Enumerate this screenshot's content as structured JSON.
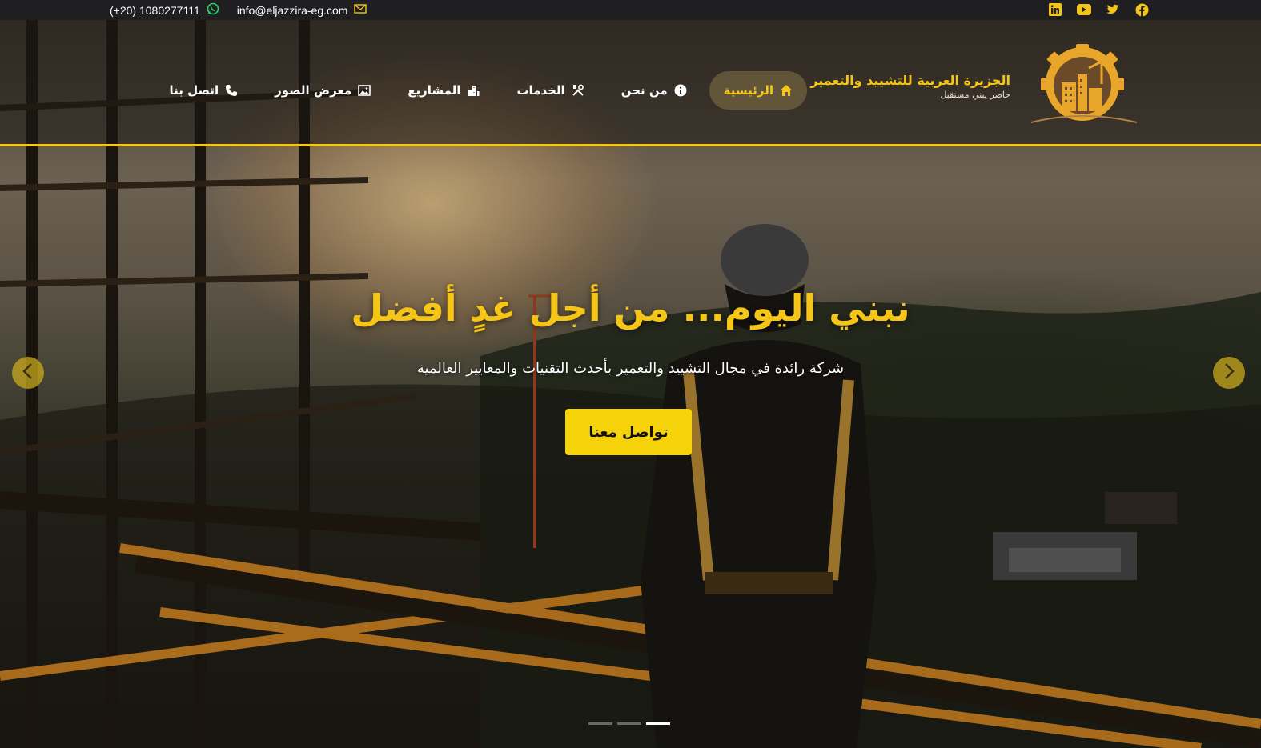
{
  "topbar": {
    "phone": "(+20) 1080277111",
    "email": "info@eljazzira-eg.com",
    "phone_icon": "whatsapp-icon",
    "email_icon": "envelope-icon",
    "socials": [
      "linkedin-icon",
      "youtube-icon",
      "twitter-icon",
      "facebook-icon"
    ]
  },
  "brand": {
    "title": "الجزيرة العربية للتشييد والتعمير",
    "tagline": "حاضر يبني مستقبل"
  },
  "nav": {
    "items": [
      {
        "label": "الرئيسية",
        "icon": "home-icon",
        "active": true
      },
      {
        "label": "من نحن",
        "icon": "info-icon",
        "active": false
      },
      {
        "label": "الخدمات",
        "icon": "tools-icon",
        "active": false
      },
      {
        "label": "المشاريع",
        "icon": "buildings-icon",
        "active": false
      },
      {
        "label": "معرض الصور",
        "icon": "image-icon",
        "active": false
      },
      {
        "label": "اتصل بنا",
        "icon": "phone-icon",
        "active": false
      }
    ]
  },
  "hero": {
    "title": "نبني اليوم... من أجل غدٍ أفضل",
    "subtitle": "شركة رائدة في مجال التشييد والتعمير بأحدث التقنيات والمعايير العالمية",
    "cta_label": "تواصل معنا",
    "slides_count": 3,
    "active_slide": 3
  },
  "colors": {
    "accent": "#f5c518",
    "button": "#f5d20a",
    "topbar": "#1f1f22"
  }
}
